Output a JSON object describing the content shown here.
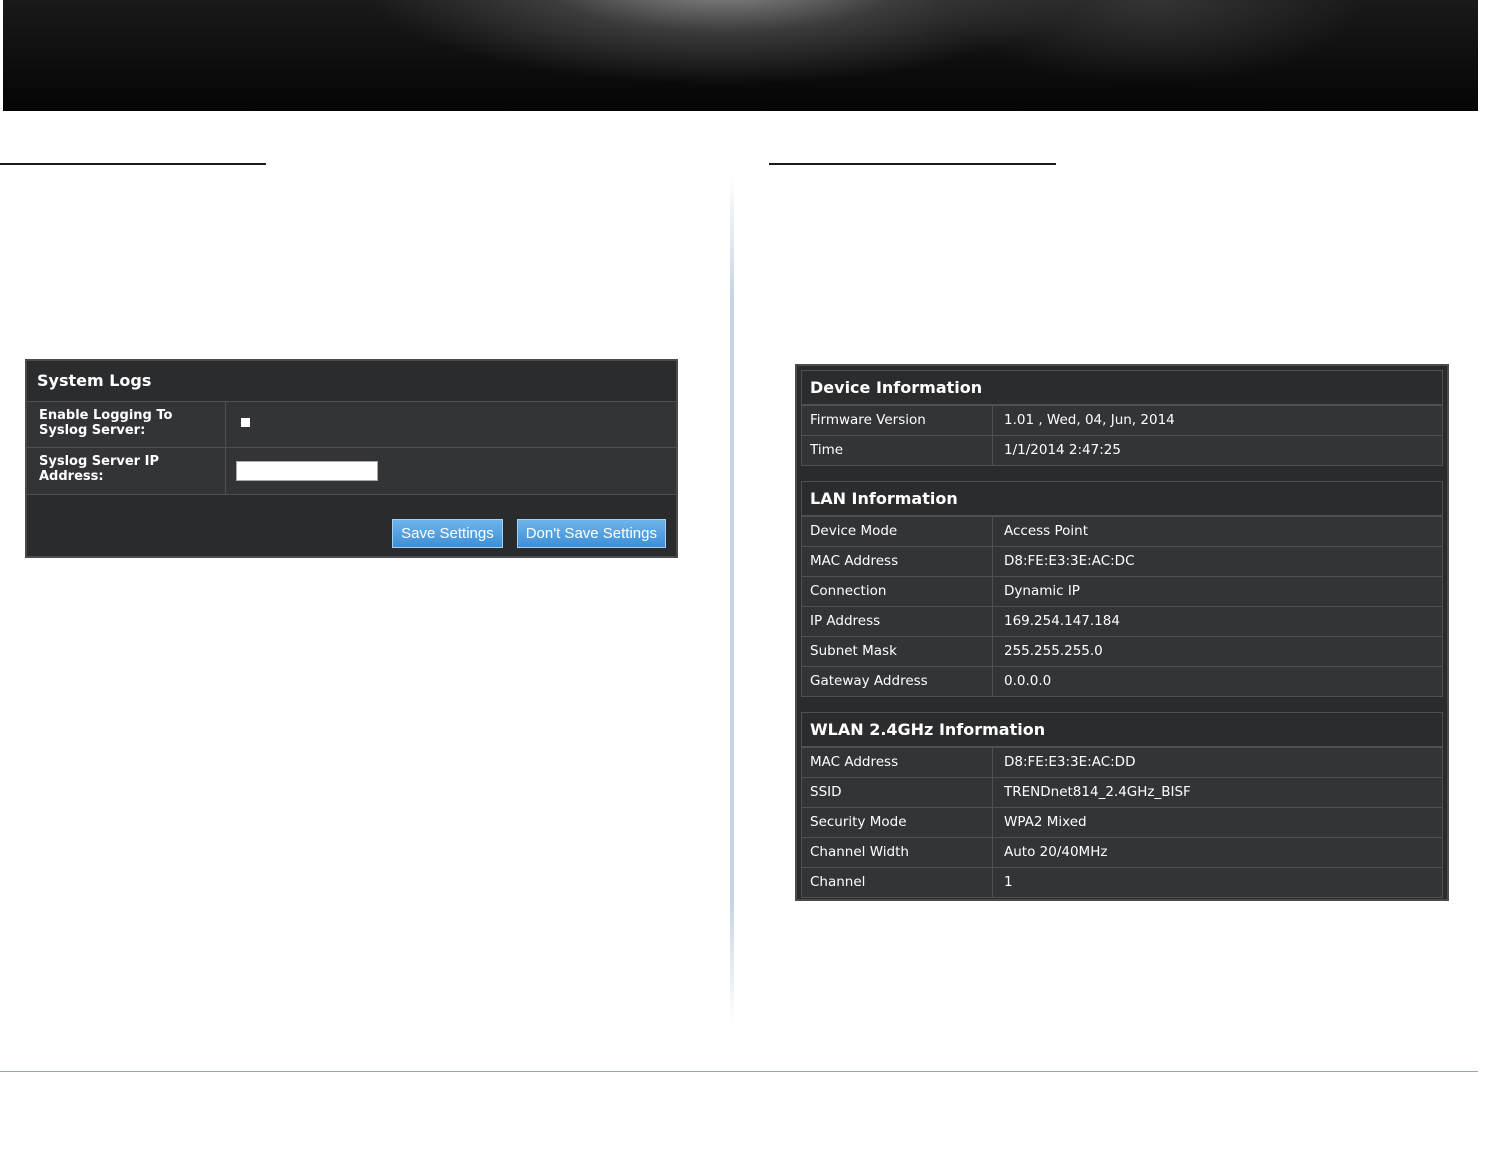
{
  "system_logs": {
    "title": "System Logs",
    "enable_logging_label": "Enable Logging To Syslog Server:",
    "enable_logging_checked": false,
    "server_ip_label": "Syslog Server IP Address:",
    "server_ip_value": "",
    "save_button": "Save Settings",
    "dont_save_button": "Don't Save Settings"
  },
  "device_info": {
    "sections": [
      {
        "title": "Device Information",
        "rows": [
          {
            "key": "Firmware Version",
            "value": "1.01 , Wed, 04, Jun, 2014"
          },
          {
            "key": "Time",
            "value": "1/1/2014 2:47:25"
          }
        ]
      },
      {
        "title": "LAN Information",
        "rows": [
          {
            "key": "Device Mode",
            "value": "Access Point"
          },
          {
            "key": "MAC Address",
            "value": "D8:FE:E3:3E:AC:DC"
          },
          {
            "key": "Connection",
            "value": "Dynamic IP"
          },
          {
            "key": "IP Address",
            "value": "169.254.147.184"
          },
          {
            "key": "Subnet Mask",
            "value": "255.255.255.0"
          },
          {
            "key": "Gateway Address",
            "value": "0.0.0.0"
          }
        ]
      },
      {
        "title": "WLAN 2.4GHz Information",
        "rows": [
          {
            "key": "MAC Address",
            "value": "D8:FE:E3:3E:AC:DD"
          },
          {
            "key": "SSID",
            "value": "TRENDnet814_2.4GHz_BISF"
          },
          {
            "key": "Security Mode",
            "value": "WPA2 Mixed"
          },
          {
            "key": "Channel Width",
            "value": "Auto 20/40MHz"
          },
          {
            "key": "Channel",
            "value": "1"
          }
        ]
      }
    ]
  }
}
